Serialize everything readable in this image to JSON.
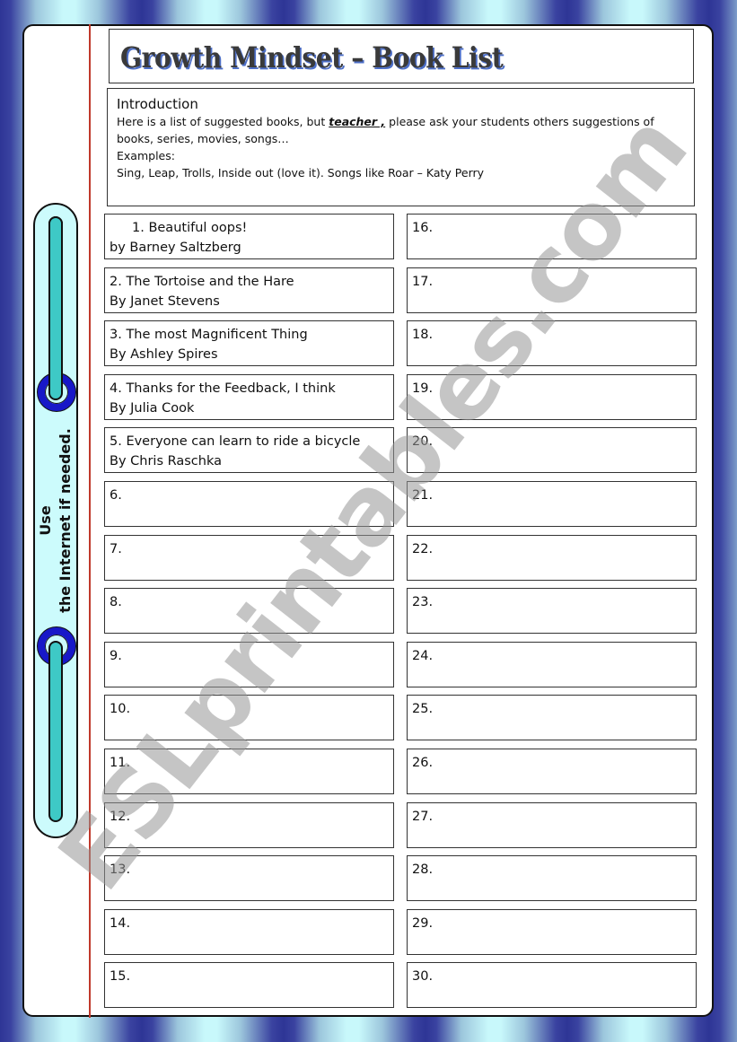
{
  "header": {
    "title": "Growth Mindset – Book List"
  },
  "intro": {
    "heading": "Introduction",
    "line1_before": "Here is a list of suggested books, but ",
    "line1_emph": "teacher ,",
    "line1_after": " please ask your students others suggestions of",
    "line2": "books, series, movies, songs…",
    "line3": "Examples:",
    "line4": "Sing, Leap, Trolls, Inside out (love it). Songs like Roar – Katy Perry"
  },
  "sidebar": {
    "line1": "Use",
    "line2": "the Internet if needed."
  },
  "watermark": "ESLprintables.com",
  "books": [
    {
      "title": "1.   Beautiful oops!",
      "author": "by Barney Saltzberg"
    },
    {
      "title": "2. The Tortoise and the Hare",
      "author": "By Janet Stevens"
    },
    {
      "title": "3. The most Magnificent Thing",
      "author": "By Ashley Spires"
    },
    {
      "title": "4. Thanks for the Feedback, I think",
      "author": "By Julia Cook"
    },
    {
      "title": "5. Everyone can learn to ride a bicycle",
      "author": "By Chris Raschka"
    },
    {
      "title": "6.",
      "author": ""
    },
    {
      "title": "7.",
      "author": ""
    },
    {
      "title": "8.",
      "author": ""
    },
    {
      "title": "9.",
      "author": ""
    },
    {
      "title": "10.",
      "author": ""
    },
    {
      "title": "11.",
      "author": ""
    },
    {
      "title": "12.",
      "author": ""
    },
    {
      "title": "13.",
      "author": ""
    },
    {
      "title": "14.",
      "author": ""
    },
    {
      "title": "15.",
      "author": ""
    },
    {
      "title": "16.",
      "author": ""
    },
    {
      "title": "17.",
      "author": ""
    },
    {
      "title": "18.",
      "author": ""
    },
    {
      "title": "19.",
      "author": ""
    },
    {
      "title": "20.",
      "author": ""
    },
    {
      "title": "21.",
      "author": ""
    },
    {
      "title": "22.",
      "author": ""
    },
    {
      "title": "23.",
      "author": ""
    },
    {
      "title": "24.",
      "author": ""
    },
    {
      "title": "25.",
      "author": ""
    },
    {
      "title": "26.",
      "author": ""
    },
    {
      "title": "27.",
      "author": ""
    },
    {
      "title": "28.",
      "author": ""
    },
    {
      "title": "29.",
      "author": ""
    },
    {
      "title": "30.",
      "author": ""
    }
  ]
}
